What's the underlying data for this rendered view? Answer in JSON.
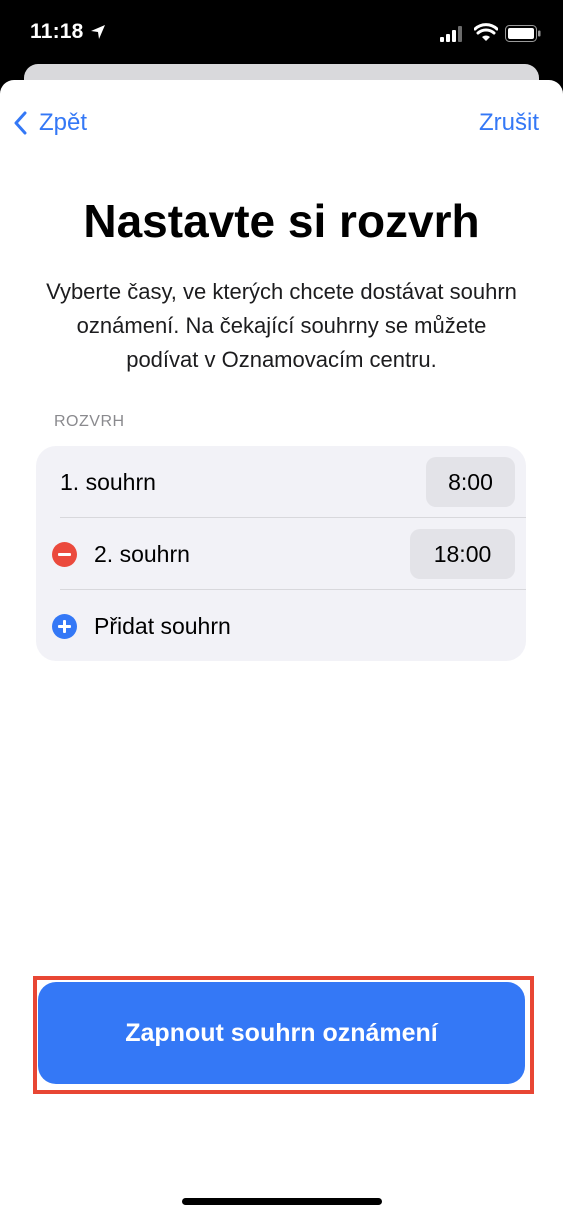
{
  "status_bar": {
    "time": "11:18",
    "icons": [
      "location-arrow-icon",
      "cellular-signal-icon",
      "wifi-icon",
      "battery-icon"
    ]
  },
  "nav": {
    "back_label": "Zpět",
    "cancel_label": "Zrušit"
  },
  "title": "Nastavte si rozvrh",
  "description": "Vyberte časy, ve kterých chcete dostávat souhrn oznámení. Na čekající souhrny se můžete podívat v Oznamovacím centru.",
  "schedule": {
    "header": "ROZVRH",
    "rows": [
      {
        "label": "1. souhrn",
        "time": "8:00"
      },
      {
        "label": "2. souhrn",
        "time": "18:00"
      }
    ],
    "add_label": "Přidat souhrn"
  },
  "primary_button": "Zapnout souhrn oznámení",
  "colors": {
    "accent": "#3478f6",
    "remove": "#eb4a3d",
    "highlight": "#e84634",
    "card_background": "#f2f2f7"
  }
}
